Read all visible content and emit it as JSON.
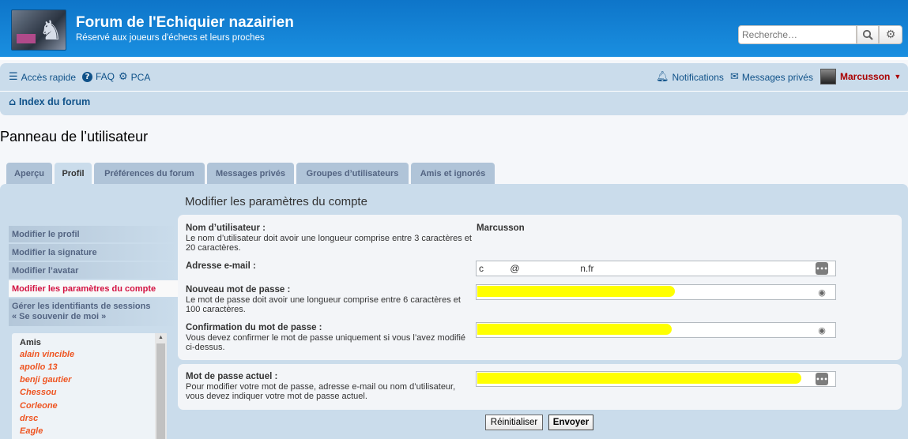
{
  "header": {
    "site_title": "Forum de l'Echiquier nazairien",
    "site_desc": "Réservé aux joueurs d'échecs et leurs proches",
    "search_placeholder": "Recherche…"
  },
  "nav": {
    "quick_access": "Accès rapide",
    "faq": "FAQ",
    "ucp": "PCA",
    "notifications": "Notifications",
    "private_messages": "Messages privés",
    "username": "Marcusson",
    "breadcrumb": "Index du forum"
  },
  "page_title": "Panneau de l’utilisateur",
  "tabs": [
    {
      "label": "Aperçu"
    },
    {
      "label": "Profil"
    },
    {
      "label": "Préférences du forum"
    },
    {
      "label": "Messages privés"
    },
    {
      "label": "Groupes d’utilisateurs"
    },
    {
      "label": "Amis et ignorés"
    }
  ],
  "menu": [
    {
      "label": "Modifier le profil"
    },
    {
      "label": "Modifier la signature"
    },
    {
      "label": "Modifier l’avatar"
    },
    {
      "label": "Modifier les paramètres du compte"
    },
    {
      "label_line1": "Gérer les identifiants de sessions",
      "label_line2": "« Se souvenir de moi »"
    }
  ],
  "friends": {
    "header": "Amis",
    "list": [
      "alain vincible",
      "apollo 13",
      "benji gautier",
      "Chessou",
      "Corleone",
      "drsc",
      "Eagle"
    ]
  },
  "form": {
    "section_title": "Modifier les paramètres du compte",
    "username_label": "Nom d’utilisateur :",
    "username_help": "Le nom d’utilisateur doit avoir une longueur comprise entre 3 caractères et 20 caractères.",
    "username_value": "Marcusson",
    "email_label": "Adresse e-mail :",
    "email_value": "c          @                       n.fr",
    "new_password_label": "Nouveau mot de passe :",
    "new_password_help": "Le mot de passe doit avoir une longueur comprise entre 6 caractères et 100 caractères.",
    "confirm_password_label": "Confirmation du mot de passe :",
    "confirm_password_help": "Vous devez confirmer le mot de passe uniquement si vous l’avez modifié ci-dessus.",
    "current_password_label": "Mot de passe actuel :",
    "current_password_help": "Pour modifier votre mot de passe, adresse e-mail ou nom d’utilisateur, vous devez indiquer votre mot de passe actuel.",
    "reset_button": "Réinitialiser",
    "submit_button": "Envoyer"
  },
  "colors": {
    "header_blue": "#0e75c9",
    "nav_bg": "#cadceb",
    "link": "#105289",
    "username": "#aa0000",
    "active_menu": "#d31141",
    "friend": "#ee5522",
    "redaction": "#ffff00"
  }
}
